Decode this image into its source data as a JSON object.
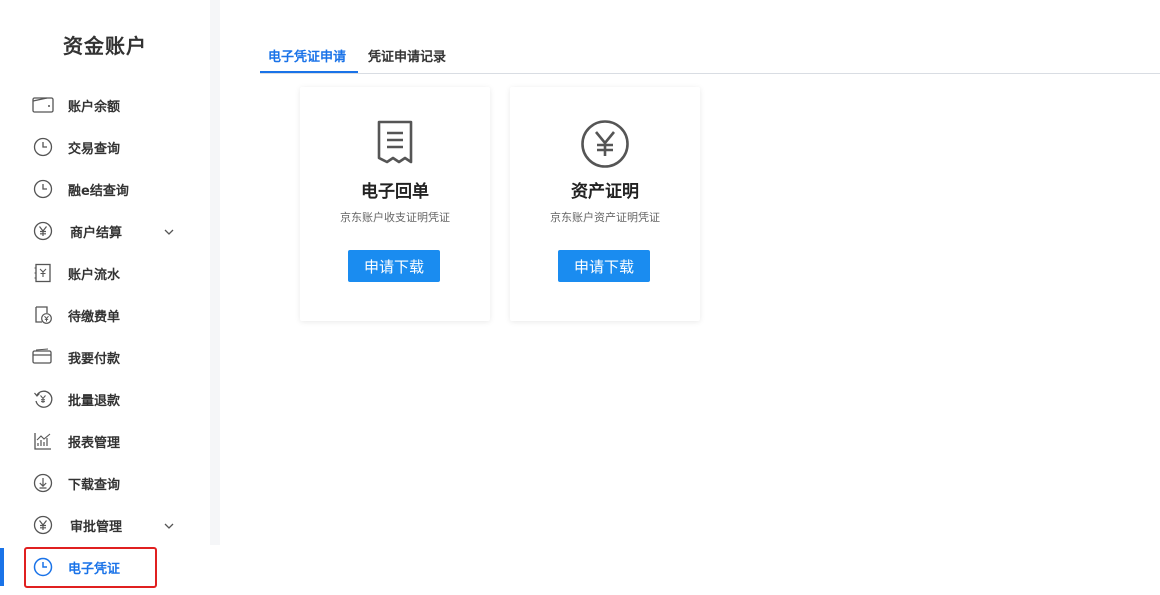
{
  "sidebar": {
    "title": "资金账户",
    "items": [
      {
        "label": "账户余额",
        "icon": "wallet-icon"
      },
      {
        "label": "交易查询",
        "icon": "clock-icon"
      },
      {
        "label": "融e结查询",
        "icon": "clock-icon"
      },
      {
        "label": "商户结算",
        "icon": "yen-circle-icon",
        "expandable": true
      },
      {
        "label": "账户流水",
        "icon": "ledger-icon"
      },
      {
        "label": "待缴费单",
        "icon": "bill-icon"
      },
      {
        "label": "我要付款",
        "icon": "card-icon"
      },
      {
        "label": "批量退款",
        "icon": "refund-icon"
      },
      {
        "label": "报表管理",
        "icon": "chart-icon"
      },
      {
        "label": "下载查询",
        "icon": "download-icon"
      },
      {
        "label": "审批管理",
        "icon": "yen-circle-icon",
        "expandable": true
      },
      {
        "label": "电子凭证",
        "icon": "clock-icon",
        "active": true
      }
    ]
  },
  "tabs": [
    {
      "label": "电子凭证申请",
      "active": true
    },
    {
      "label": "凭证申请记录",
      "active": false
    }
  ],
  "cards": [
    {
      "title": "电子回单",
      "description": "京东账户收支证明凭证",
      "button": "申请下载",
      "icon": "receipt-icon"
    },
    {
      "title": "资产证明",
      "description": "京东账户资产证明凭证",
      "button": "申请下载",
      "icon": "yen-circle-icon"
    }
  ],
  "colors": {
    "accent": "#1a73e8",
    "button": "#1a8cf0",
    "highlight": "#e02020"
  }
}
